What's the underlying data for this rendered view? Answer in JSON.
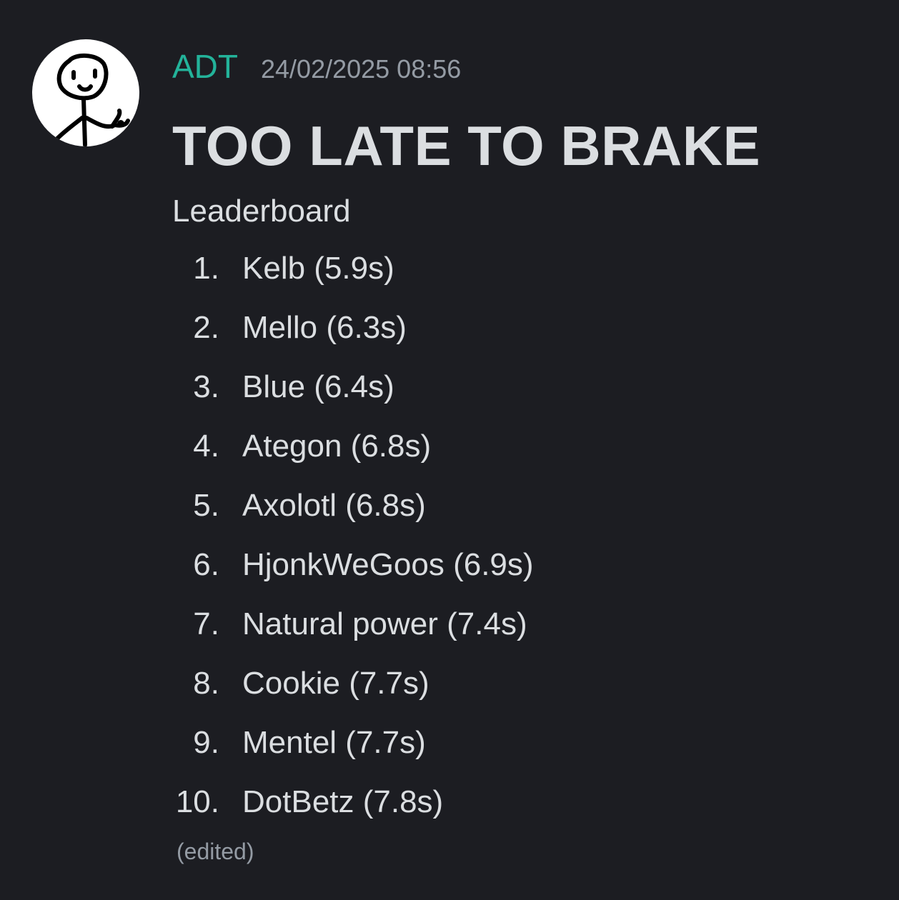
{
  "message": {
    "author": "ADT",
    "timestamp": "24/02/2025 08:56",
    "title": "TOO LATE TO BRAKE",
    "subtitle": "Leaderboard",
    "edited_label": "(edited)",
    "avatar_icon": "stick-figure-thumbs-up-icon",
    "author_color": "#23b39a",
    "leaderboard": [
      {
        "rank": "1.",
        "text": "Kelb (5.9s)"
      },
      {
        "rank": "2.",
        "text": "Mello (6.3s)"
      },
      {
        "rank": "3.",
        "text": "Blue (6.4s)"
      },
      {
        "rank": "4.",
        "text": "Ategon (6.8s)"
      },
      {
        "rank": "5.",
        "text": "Axolotl (6.8s)"
      },
      {
        "rank": "6.",
        "text": "HjonkWeGoos (6.9s)"
      },
      {
        "rank": "7.",
        "text": "Natural power (7.4s)"
      },
      {
        "rank": "8.",
        "text": "Cookie (7.7s)"
      },
      {
        "rank": "9.",
        "text": "Mentel (7.7s)"
      },
      {
        "rank": "10.",
        "text": "DotBetz (7.8s)"
      }
    ]
  }
}
